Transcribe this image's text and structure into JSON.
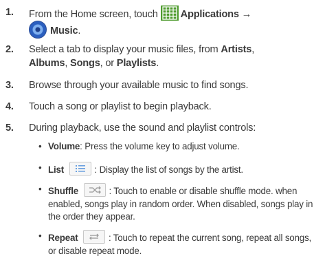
{
  "steps": [
    {
      "num": "1.",
      "a": "From the Home screen, touch",
      "b": "Applications →",
      "c": "Music",
      "d": "."
    },
    {
      "num": "2.",
      "a": "Select a tab to display your music files, from ",
      "b": "Artists",
      "c": ", ",
      "d": "Albums",
      "e": ", ",
      "f": "Songs",
      "g": ", or ",
      "h": "Playlists",
      "i": "."
    },
    {
      "num": "3.",
      "text": "Browse through your available music to find songs."
    },
    {
      "num": "4.",
      "text": "Touch a song or playlist to begin playback."
    },
    {
      "num": "5.",
      "text": "During playback, use the sound and playlist controls:"
    }
  ],
  "sub": [
    {
      "bullet": "•",
      "term": "Volume",
      "desc": ": Press the volume key to adjust volume."
    },
    {
      "bullet": "•",
      "term": "List",
      "desc": " : Display the list of songs by the artist."
    },
    {
      "bullet": "•",
      "term": "Shuffle",
      "desc": " : Touch to enable or disable shuffle mode. when enabled, songs play in random order. When disabled, songs play in the order they appear."
    },
    {
      "bullet": "•",
      "term": "Repeat",
      "desc": " : Touch to repeat the current song, repeat all songs, or disable repeat mode."
    }
  ],
  "icons": {
    "applications": "grid-icon",
    "music": "music-disc-icon",
    "list": "list-icon",
    "shuffle": "shuffle-icon",
    "repeat": "repeat-icon"
  }
}
